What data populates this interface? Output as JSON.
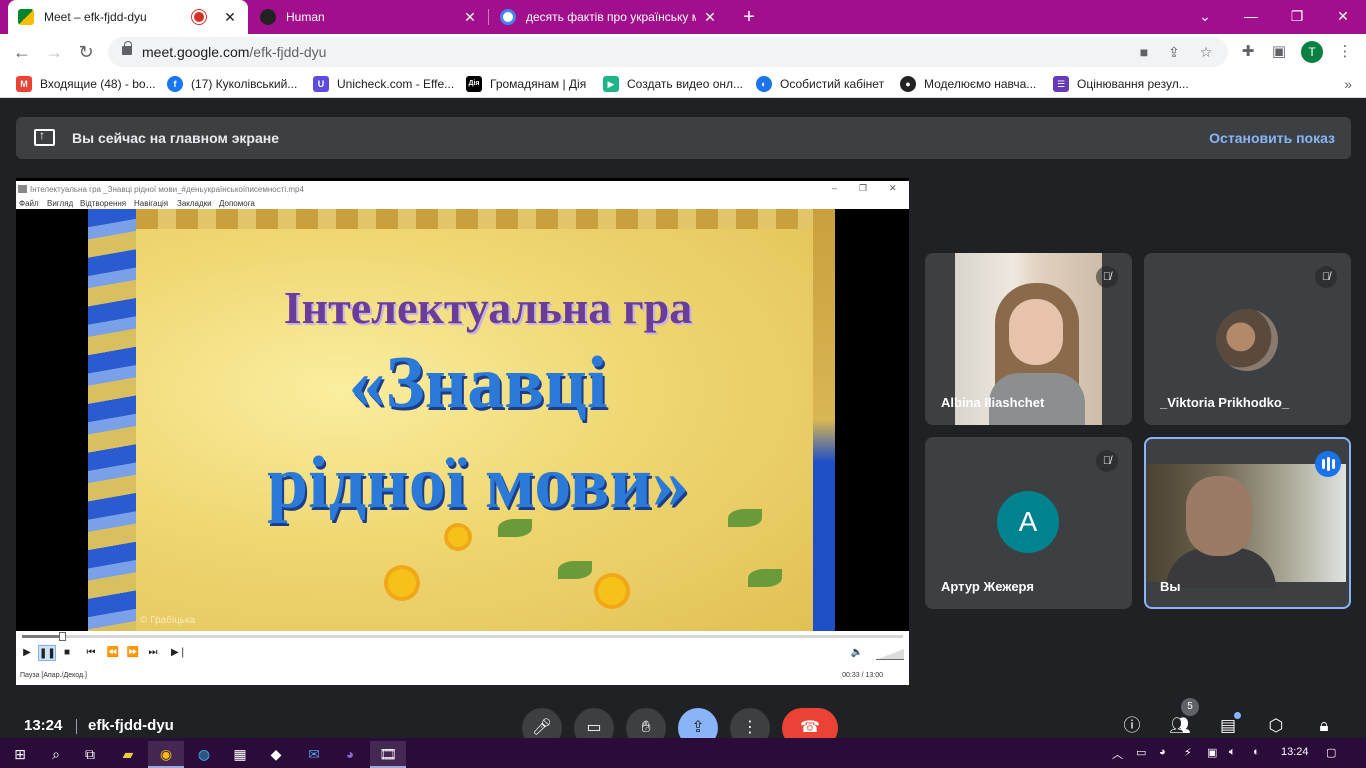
{
  "browser": {
    "tabs": [
      {
        "title": "Meet – efk-fjdd-dyu",
        "recording": true
      },
      {
        "title": "Human"
      },
      {
        "title": "десять фактів про українську мо"
      }
    ],
    "url_host": "meet.google.com",
    "url_path": "/efk-fjdd-dyu",
    "profile_initial": "T"
  },
  "bookmarks": [
    {
      "label": "Входящие (48) - bo...",
      "color": "#ea4335",
      "glyph": "M"
    },
    {
      "label": "(17) Куколівський...",
      "color": "#1877f2",
      "glyph": "f"
    },
    {
      "label": "Unicheck.com - Effe...",
      "color": "#5b4cdb",
      "glyph": "U"
    },
    {
      "label": "Громадянам | Дія",
      "color": "#000000",
      "glyph": "Дія"
    },
    {
      "label": "Создать видео онл...",
      "color": "#1fb589",
      "glyph": "▶"
    },
    {
      "label": "Особистий кабінет",
      "color": "#1a73e8",
      "glyph": "◐"
    },
    {
      "label": "Моделюємо навча...",
      "color": "#222222",
      "glyph": "●"
    },
    {
      "label": "Оцінювання резул...",
      "color": "#673ab7",
      "glyph": "☰"
    }
  ],
  "banner": {
    "text": "Вы сейчас на главном экране",
    "stop": "Остановить показ"
  },
  "player": {
    "title": "Інтелектуальна гра _Знавці рідної мови_#деньукраїнськоїписемності.mp4",
    "menu": [
      "Файл",
      "Вигляд",
      "Відтворення",
      "Навігація",
      "Закладки",
      "Допомога"
    ],
    "video_line1": "Інтелектуальна гра",
    "video_line2": "«Знавці",
    "video_line3": "рідної мови»",
    "watermark": "© Грабіцька",
    "status_left": "Пауза [Апар./Декод.]",
    "status_right": "00:33 / 13:00",
    "progress": 0.042
  },
  "participants": [
    {
      "name": "Albina Iliashchet",
      "muted": true
    },
    {
      "name": "_Viktoria Prikhodko_",
      "muted": true
    },
    {
      "name": "Артур Жежеря",
      "muted": true,
      "initial": "A"
    },
    {
      "name": "Вы",
      "speaking": true
    }
  ],
  "meeting": {
    "time": "13:24",
    "code": "efk-fjdd-dyu",
    "participant_count": "5"
  },
  "taskbar": {
    "clock": "13:24"
  }
}
